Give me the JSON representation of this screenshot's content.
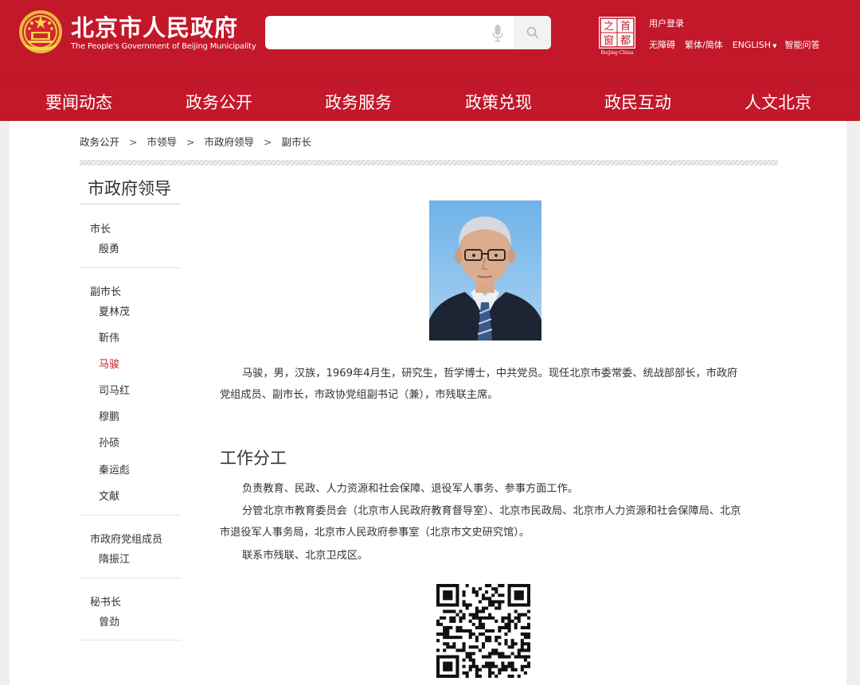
{
  "header": {
    "site_title": "北京市人民政府",
    "site_subtitle": "The People's Government of Beijing Municipality",
    "search_placeholder": "",
    "capital_logo_chars": [
      "之",
      "首",
      "都",
      "窗"
    ],
    "capital_logo_caption": "Beijing·China",
    "login_label": "用户登录",
    "util_links": [
      "无障碍",
      "繁体/简体",
      "ENGLISH",
      "智能问答"
    ]
  },
  "nav": {
    "items": [
      "要闻动态",
      "政务公开",
      "政务服务",
      "政策兑现",
      "政民互动",
      "人文北京"
    ]
  },
  "breadcrumb": {
    "items": [
      "政务公开",
      "市领导",
      "市政府领导",
      "副市长"
    ],
    "separator": ">"
  },
  "sidebar": {
    "title": "市政府领导",
    "groups": [
      {
        "title": "市长",
        "people": [
          "殷勇"
        ]
      },
      {
        "title": "副市长",
        "people": [
          "夏林茂",
          "靳伟",
          "马骏",
          "司马红",
          "穆鹏",
          "孙硕",
          "秦运彪",
          "文献"
        ]
      },
      {
        "title": "市政府党组成员",
        "people": [
          "隋振江"
        ]
      },
      {
        "title": "秘书长",
        "people": [
          "曾劲"
        ]
      }
    ],
    "active_person": "马骏"
  },
  "main": {
    "bio": "马骏，男，汉族，1969年4月生，研究生，哲学博士，中共党员。现任北京市委常委、统战部部长，市政府党组成员、副市长，市政协党组副书记（兼），市残联主席。",
    "duty_title": "工作分工",
    "duty_paragraphs": [
      "负责教育、民政、人力资源和社会保障、退役军人事务、参事方面工作。",
      "分管北京市教育委员会（北京市人民政府教育督导室）、北京市民政局、北京市人力资源和社会保障局、北京市退役军人事务局，北京市人民政府参事室（北京市文史研究馆）。",
      "联系市残联、北京卫戍区。"
    ]
  },
  "colors": {
    "brand_red": "#c3172a",
    "active_link": "#c3172a",
    "text": "#333333"
  },
  "icons": [
    "national-emblem-icon",
    "microphone-icon",
    "search-icon",
    "dropdown-arrow-icon",
    "qr-code-icon"
  ]
}
